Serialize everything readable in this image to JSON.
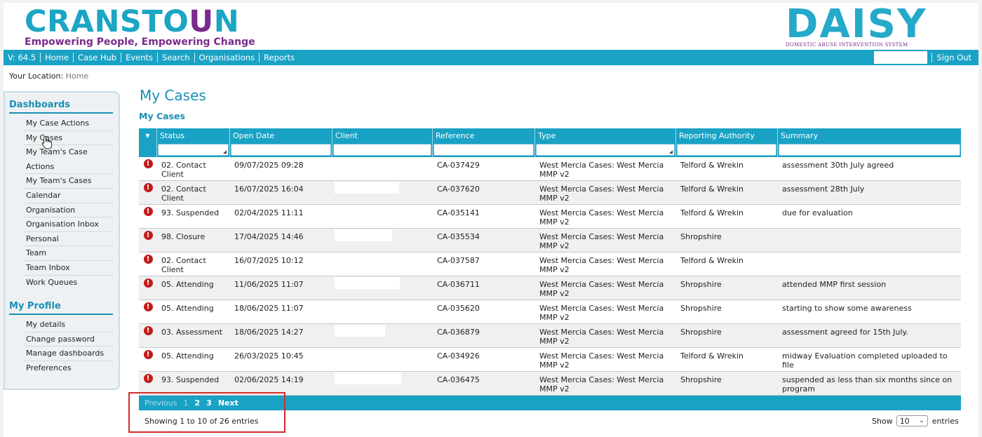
{
  "header": {
    "logo_word_a": "CRANSTO",
    "logo_word_u": "U",
    "logo_word_b": "N",
    "logo_tagline": "Empowering People, Empowering Change",
    "daisy_word": "DAISY",
    "daisy_sub": "DOMESTIC ABUSE INTERVENTION SYSTEM"
  },
  "nav": {
    "version": "V: 64.5",
    "items": [
      "Home",
      "Case Hub",
      "Events",
      "Search",
      "Organisations",
      "Reports"
    ],
    "sign_out": "Sign Out"
  },
  "location": {
    "label": "Your Location:",
    "value": "Home"
  },
  "sidebar": {
    "dashboards_title": "Dashboards",
    "dashboards": [
      "My Case Actions",
      "My Cases",
      "My Team's Case",
      "Actions",
      "My Team's Cases",
      "Calendar",
      "Organisation",
      "Organisation Inbox",
      "Personal",
      "Team",
      "Team Inbox",
      "Work Queues"
    ],
    "profile_title": "My Profile",
    "profile": [
      "My details",
      "Change password",
      "Manage dashboards",
      "Preferences"
    ]
  },
  "main": {
    "title": "My Cases",
    "subtitle": "My Cases"
  },
  "table": {
    "sort_glyph": "▼",
    "columns": [
      "Status",
      "Open Date",
      "Client",
      "Reference",
      "Type",
      "Reporting Authority",
      "Summary"
    ],
    "rows": [
      {
        "status": "02. Contact Client",
        "date": "09/07/2025 09:28",
        "ref": "CA-037429",
        "type": "West Mercia Cases: West Mercia MMP v2",
        "authority": "Telford & Wrekin",
        "summary": "assessment 30th July agreed"
      },
      {
        "status": "02. Contact Client",
        "date": "16/07/2025 16:04",
        "ref": "CA-037620",
        "type": "West Mercia Cases: West Mercia MMP v2",
        "authority": "Telford & Wrekin",
        "summary": "assessment 28th July"
      },
      {
        "status": "93. Suspended",
        "date": "02/04/2025 11:11",
        "ref": "CA-035141",
        "type": "West Mercia Cases: West Mercia MMP v2",
        "authority": "Telford & Wrekin",
        "summary": "due for evaluation"
      },
      {
        "status": "98. Closure",
        "date": "17/04/2025 14:46",
        "ref": "CA-035534",
        "type": "West Mercia Cases: West Mercia MMP v2",
        "authority": "Shropshire",
        "summary": ""
      },
      {
        "status": "02. Contact Client",
        "date": "16/07/2025 10:12",
        "ref": "CA-037587",
        "type": "West Mercia Cases: West Mercia MMP v2",
        "authority": "Telford & Wrekin",
        "summary": ""
      },
      {
        "status": "05. Attending",
        "date": "11/06/2025 11:07",
        "ref": "CA-036711",
        "type": "West Mercia Cases: West Mercia MMP v2",
        "authority": "Shropshire",
        "summary": "attended MMP first session"
      },
      {
        "status": "05. Attending",
        "date": "18/06/2025 11:07",
        "ref": "CA-035620",
        "type": "West Mercia Cases: West Mercia MMP v2",
        "authority": "Shropshire",
        "summary": "starting to show some awareness"
      },
      {
        "status": "03. Assessment",
        "date": "18/06/2025 14:27",
        "ref": "CA-036879",
        "type": "West Mercia Cases: West Mercia MMP v2",
        "authority": "Shropshire",
        "summary": "assessment agreed for 15th July."
      },
      {
        "status": "05. Attending",
        "date": "26/03/2025 10:45",
        "ref": "CA-034926",
        "type": "West Mercia Cases: West Mercia MMP v2",
        "authority": "Telford & Wrekin",
        "summary": "midway Evaluation completed uploaded to file"
      },
      {
        "status": "93. Suspended",
        "date": "02/06/2025 14:19",
        "ref": "CA-036475",
        "type": "West Mercia Cases: West Mercia MMP v2",
        "authority": "Shropshire",
        "summary": "suspended as less than six months since on program"
      }
    ]
  },
  "pager": {
    "previous": "Previous",
    "pages": [
      "1",
      "2",
      "3"
    ],
    "next": "Next",
    "info": "Showing 1 to 10 of 26 entries",
    "show_label": "Show",
    "show_value": "10",
    "entries_label": "entries"
  },
  "colors": {
    "accent": "#1aa2c5",
    "brand_purple": "#7a2a8c",
    "error": "#c41a1a",
    "highlight_box": "#d42b2b"
  }
}
